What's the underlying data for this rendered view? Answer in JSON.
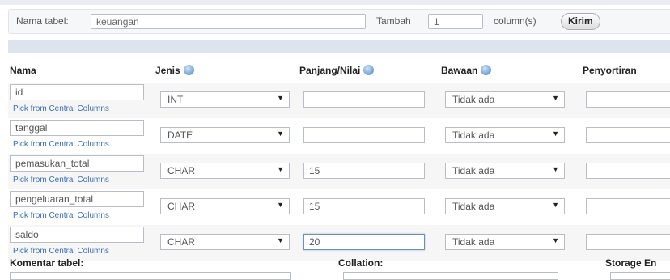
{
  "topbar": {
    "table_name_label": "Nama tabel:",
    "table_name_value": "keuangan",
    "add_label": "Tambah",
    "add_count": "1",
    "columns_label": "column(s)",
    "submit_label": "Kirim"
  },
  "headers": {
    "name": "Nama",
    "type": "Jenis",
    "length": "Panjang/Nilai",
    "default": "Bawaan",
    "collation": "Penyortiran"
  },
  "pick_label": "Pick from Central Columns",
  "rows": [
    {
      "name": "id",
      "type": "INT",
      "length": "",
      "default": "Tidak ada"
    },
    {
      "name": "tanggal",
      "type": "DATE",
      "length": "",
      "default": "Tidak ada"
    },
    {
      "name": "pemasukan_total",
      "type": "CHAR",
      "length": "15",
      "default": "Tidak ada"
    },
    {
      "name": "pengeluaran_total",
      "type": "CHAR",
      "length": "15",
      "default": "Tidak ada"
    },
    {
      "name": "saldo",
      "type": "CHAR",
      "length": "20",
      "default": "Tidak ada"
    }
  ],
  "footer": {
    "comment_label": "Komentar tabel:",
    "collation_label": "Collation:",
    "storage_label": "Storage En"
  },
  "icons": {
    "help": "help-icon",
    "dropdown": "dropdown-arrow-icon"
  }
}
